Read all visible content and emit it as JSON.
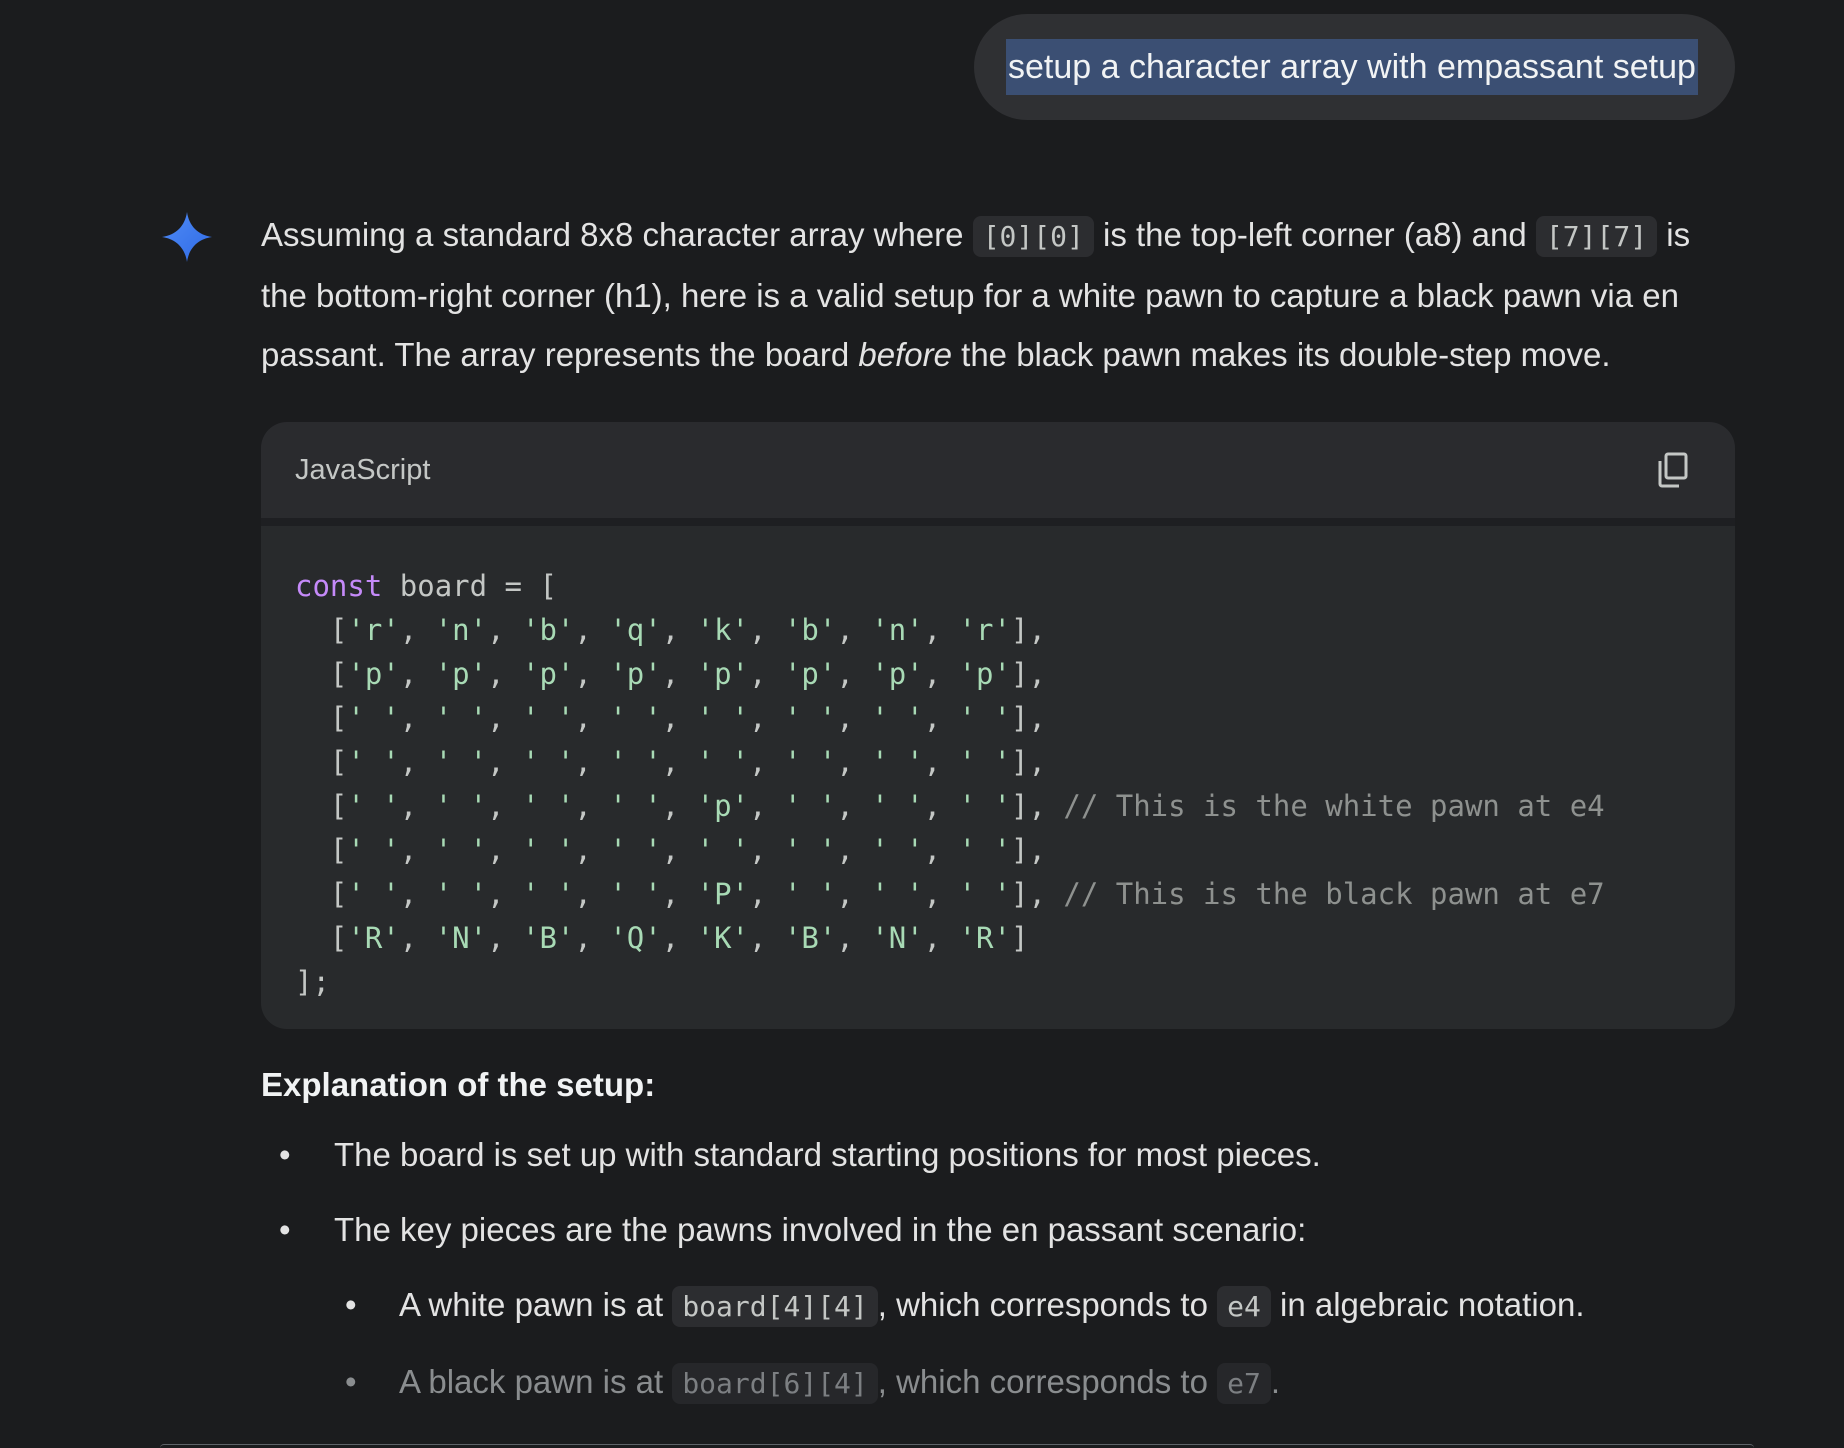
{
  "user_message": "setup a character array with empassant setup",
  "response": {
    "intro": {
      "t1": "Assuming a standard 8x8 character array where ",
      "c1": "[0][0]",
      "t2": " is the top-left corner (a8) and ",
      "c2": "[7][7]",
      "t3": " is the bottom-right corner (h1), here is a valid setup for a white pawn to capture a black pawn via en passant. The array represents the board ",
      "em": "before",
      "t4": " the black pawn makes its double-step move."
    },
    "code_block": {
      "language": "JavaScript",
      "copy_icon": "copy-icon",
      "keyword": "const",
      "decl": " board = [",
      "rows": [
        {
          "cells": [
            "'r'",
            "'n'",
            "'b'",
            "'q'",
            "'k'",
            "'b'",
            "'n'",
            "'r'"
          ],
          "comment": ""
        },
        {
          "cells": [
            "'p'",
            "'p'",
            "'p'",
            "'p'",
            "'p'",
            "'p'",
            "'p'",
            "'p'"
          ],
          "comment": ""
        },
        {
          "cells": [
            "' '",
            "' '",
            "' '",
            "' '",
            "' '",
            "' '",
            "' '",
            "' '"
          ],
          "comment": ""
        },
        {
          "cells": [
            "' '",
            "' '",
            "' '",
            "' '",
            "' '",
            "' '",
            "' '",
            "' '"
          ],
          "comment": ""
        },
        {
          "cells": [
            "' '",
            "' '",
            "' '",
            "' '",
            "'p'",
            "' '",
            "' '",
            "' '"
          ],
          "comment": "// This is the white pawn at e4"
        },
        {
          "cells": [
            "' '",
            "' '",
            "' '",
            "' '",
            "' '",
            "' '",
            "' '",
            "' '"
          ],
          "comment": ""
        },
        {
          "cells": [
            "' '",
            "' '",
            "' '",
            "' '",
            "'P'",
            "' '",
            "' '",
            "' '"
          ],
          "comment": "// This is the black pawn at e7"
        },
        {
          "cells": [
            "'R'",
            "'N'",
            "'B'",
            "'Q'",
            "'K'",
            "'B'",
            "'N'",
            "'R'"
          ],
          "comment": ""
        }
      ],
      "closing": "];"
    },
    "explanation": {
      "title": "Explanation of the setup:",
      "b1": "The board is set up with standard starting positions for most pieces.",
      "b2": "The key pieces are the pawns involved in the en passant scenario:",
      "s1": {
        "t1": "A white pawn is at ",
        "c1": "board[4][4]",
        "t2": ", which corresponds to ",
        "c2": "e4",
        "t3": " in algebraic notation."
      },
      "s2": {
        "t1": "A black pawn is at ",
        "c1": "board[6][4]",
        "t2": ", which corresponds to ",
        "c2": "e7",
        "t3": "."
      }
    }
  },
  "colors": {
    "background": "#1b1c1e",
    "user_bubble": "#2f3033",
    "selection": "#3b4f73",
    "code_keyword": "#c58af9",
    "code_string": "#a8dab5",
    "code_comment": "#8e918f"
  }
}
